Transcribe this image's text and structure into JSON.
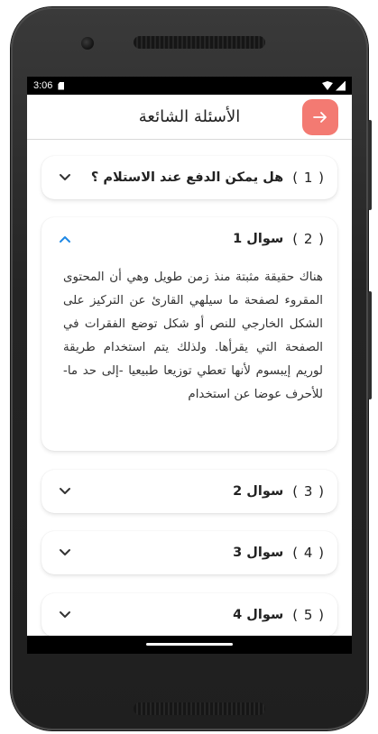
{
  "statusbar": {
    "time": "3:06"
  },
  "appbar": {
    "title": "الأسئلة الشائعة",
    "back_icon": "arrow-right-icon",
    "accent": "#f37a72"
  },
  "faq": [
    {
      "number": "( 1 )",
      "question": "هل يمكن الدفع عند الاستلام ؟",
      "expanded": false
    },
    {
      "number": "( 2 )",
      "question": "سوال 1",
      "expanded": true,
      "answer": "هناك حقيقة مثبتة منذ زمن طويل وهي أن المحتوى المقروء لصفحة ما سيلهي القارئ عن التركيز على الشكل الخارجي للنص أو شكل توضع الفقرات في الصفحة التي يقرأها. ولذلك يتم استخدام طريقة لوريم إيبسوم لأنها تعطي توزيعا طبيعيا -إلى حد ما- للأحرف عوضا عن استخدام"
    },
    {
      "number": "( 3 )",
      "question": "سوال 2",
      "expanded": false
    },
    {
      "number": "( 4 )",
      "question": "سوال 3",
      "expanded": false
    },
    {
      "number": "( 5 )",
      "question": "سوال 4",
      "expanded": false
    }
  ],
  "colors": {
    "chevron_collapsed": "#333333",
    "chevron_expanded": "#1e88e5"
  }
}
